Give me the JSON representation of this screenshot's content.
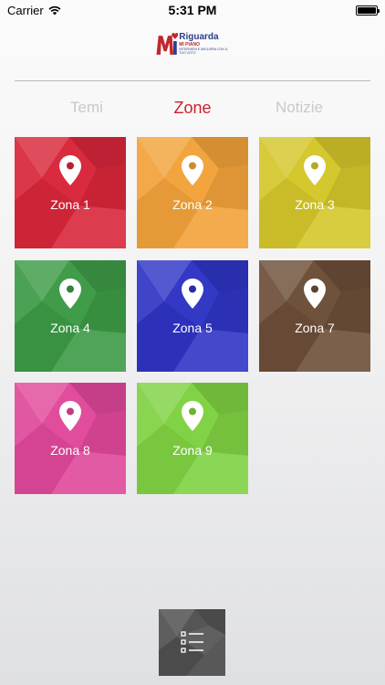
{
  "status_bar": {
    "carrier": "Carrier",
    "time": "5:31 PM",
    "wifi_icon": "wifi-icon",
    "battery_icon": "battery-icon"
  },
  "logo": {
    "mark": "Mi",
    "name": "Riguarda",
    "subtitle": "MI PIANO",
    "tagline": "INTERVIENI E MIGLIORA CON IL TUO VOTO"
  },
  "tabs": [
    {
      "label": "Temi",
      "active": false
    },
    {
      "label": "Zone",
      "active": true
    },
    {
      "label": "Notizie",
      "active": false
    }
  ],
  "zones": [
    {
      "label": "Zona 1",
      "color": "#d8263a"
    },
    {
      "label": "Zona 2",
      "color": "#f2a23a"
    },
    {
      "label": "Zona 3",
      "color": "#d4c62a"
    },
    {
      "label": "Zona 4",
      "color": "#3c9a45"
    },
    {
      "label": "Zona 5",
      "color": "#2f34c4"
    },
    {
      "label": "Zona 7",
      "color": "#6c4e38"
    },
    {
      "label": "Zona 8",
      "color": "#e0489a"
    },
    {
      "label": "Zona 9",
      "color": "#7fd142"
    }
  ],
  "bottom_button": {
    "icon": "list-icon",
    "color": "#555555"
  },
  "accent_color": "#cc1f2d"
}
